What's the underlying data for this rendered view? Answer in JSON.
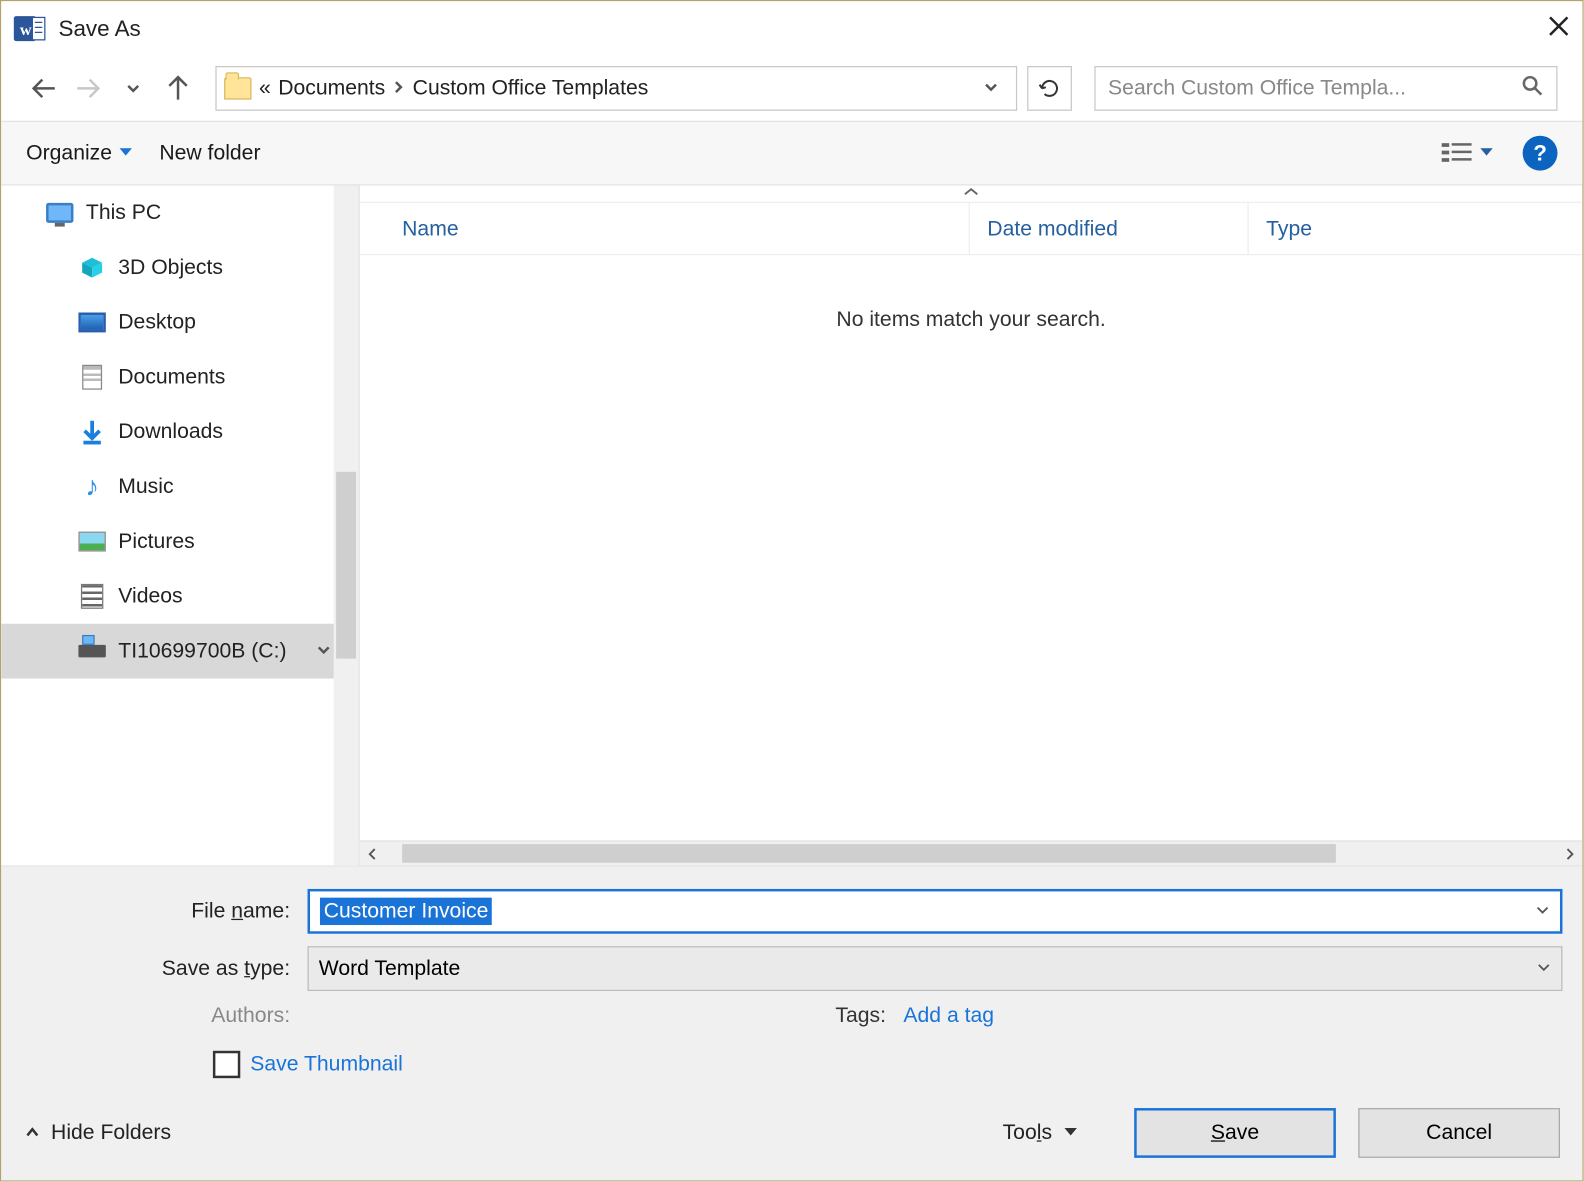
{
  "title": "Save As",
  "breadcrumb": {
    "prefix": "«",
    "seg1": "Documents",
    "seg2": "Custom Office Templates"
  },
  "search": {
    "placeholder": "Search Custom Office Templa..."
  },
  "toolbar": {
    "organize": "Organize",
    "new_folder": "New folder"
  },
  "tree": {
    "this_pc": "This PC",
    "objects3d": "3D Objects",
    "desktop": "Desktop",
    "documents": "Documents",
    "downloads": "Downloads",
    "music": "Music",
    "pictures": "Pictures",
    "videos": "Videos",
    "drive_c": "TI10699700B (C:)"
  },
  "columns": {
    "name": "Name",
    "date": "Date modified",
    "type": "Type"
  },
  "empty_message": "No items match your search.",
  "form": {
    "filename_label_pre": "File ",
    "filename_label_u": "n",
    "filename_label_post": "ame:",
    "filename_value": "Customer Invoice",
    "type_label_pre": "Save as ",
    "type_label_u": "t",
    "type_label_post": "ype:",
    "type_value": "Word Template",
    "authors_label": "Authors:",
    "tags_label": "Tags:",
    "tags_link": "Add a tag",
    "thumb_label": "Save Thumbnail"
  },
  "footer": {
    "hide": "Hide Folders",
    "tools_pre": "Too",
    "tools_u": "l",
    "tools_post": "s",
    "save_u": "S",
    "save_post": "ave",
    "cancel": "Cancel"
  }
}
